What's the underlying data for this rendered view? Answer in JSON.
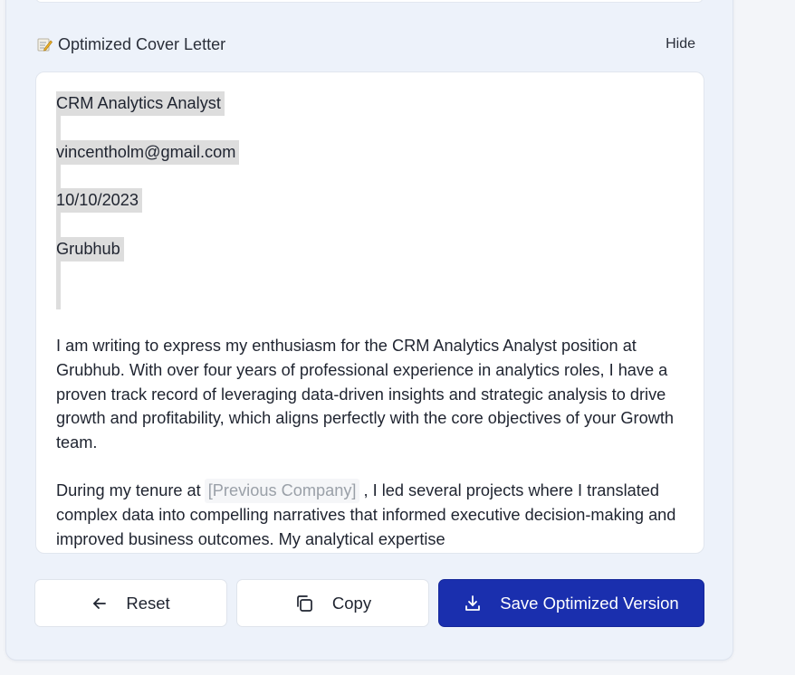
{
  "section": {
    "icon": "memo-icon",
    "title": "Optimized Cover Letter",
    "hide_label": "Hide"
  },
  "letter": {
    "header_lines": [
      "CRM Analytics Analyst",
      "vincentholm@gmail.com",
      "10/10/2023",
      "Grubhub"
    ],
    "paragraph1": "I am writing to express my enthusiasm for the CRM Analytics Analyst position at Grubhub. With over four years of professional experience in analytics roles, I have a proven track record of leveraging data-driven insights and strategic analysis to drive growth and profitability, which aligns perfectly with the core objectives of your Growth team.",
    "paragraph2_before": "During my tenure at",
    "paragraph2_placeholder": "[Previous Company]",
    "paragraph2_after": ", I led several projects where I translated complex data into compelling narratives that informed executive decision-making and improved business outcomes. My analytical expertise"
  },
  "actions": {
    "reset_label": "Reset",
    "reset_icon": "arrow-left-icon",
    "copy_label": "Copy",
    "copy_icon": "copy-icon",
    "save_label": "Save Optimized Version",
    "save_icon": "download-icon"
  },
  "colors": {
    "primary": "#1a2fae",
    "highlight": "#dddddd",
    "panel_bg": "#edf2fa"
  }
}
